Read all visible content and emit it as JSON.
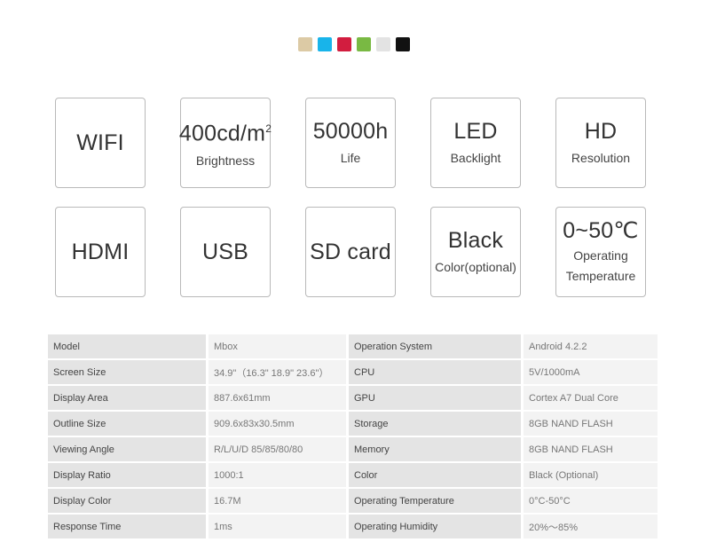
{
  "color_swatches": [
    {
      "name": "gold",
      "color": "#dccaa5"
    },
    {
      "name": "blue",
      "color": "#18b4ea"
    },
    {
      "name": "red",
      "color": "#d21d3f"
    },
    {
      "name": "green",
      "color": "#79b943"
    },
    {
      "name": "white",
      "color": "#e3e3e3"
    },
    {
      "name": "black",
      "color": "#111111"
    }
  ],
  "features": [
    {
      "main": "WIFI",
      "sub": "",
      "sub2": ""
    },
    {
      "main": "400cd/m",
      "sup": "2",
      "sub": "Brightness",
      "sub2": ""
    },
    {
      "main": "50000h",
      "sub": "Life",
      "sub2": ""
    },
    {
      "main": "LED",
      "sub": "Backlight",
      "sub2": ""
    },
    {
      "main": "HD",
      "sub": "Resolution",
      "sub2": ""
    },
    {
      "main": "HDMI",
      "sub": "",
      "sub2": ""
    },
    {
      "main": "USB",
      "sub": "",
      "sub2": ""
    },
    {
      "main": "SD card",
      "sub": "",
      "sub2": ""
    },
    {
      "main": "Black",
      "sub": "Color(optional)",
      "sub2": ""
    },
    {
      "main": "0~50℃",
      "sub": "Operating",
      "sub2": "Temperature"
    }
  ],
  "specs": [
    {
      "k1": "Model",
      "v1": "Mbox",
      "k2": "Operation System",
      "v2": "Android 4.2.2"
    },
    {
      "k1": "Screen Size",
      "v1": "34.9\"（16.3\"  18.9\"  23.6\"）",
      "k2": "CPU",
      "v2": "5V/1000mA"
    },
    {
      "k1": "Display Area",
      "v1": "887.6x61mm",
      "k2": "GPU",
      "v2": "Cortex A7 Dual Core"
    },
    {
      "k1": "Outline Size",
      "v1": "909.6x83x30.5mm",
      "k2": "Storage",
      "v2": "8GB NAND FLASH"
    },
    {
      "k1": "Viewing Angle",
      "v1": "R/L/U/D   85/85/80/80",
      "k2": "Memory",
      "v2": "8GB NAND FLASH"
    },
    {
      "k1": "Display Ratio",
      "v1": "1000:1",
      "k2": "Color",
      "v2": "Black (Optional)"
    },
    {
      "k1": "Display Color",
      "v1": "16.7M",
      "k2": "Operating Temperature",
      "v2": "0°C-50°C"
    },
    {
      "k1": "Response Time",
      "v1": "1ms",
      "k2": "Operating Humidity",
      "v2": "20%～85%"
    }
  ]
}
